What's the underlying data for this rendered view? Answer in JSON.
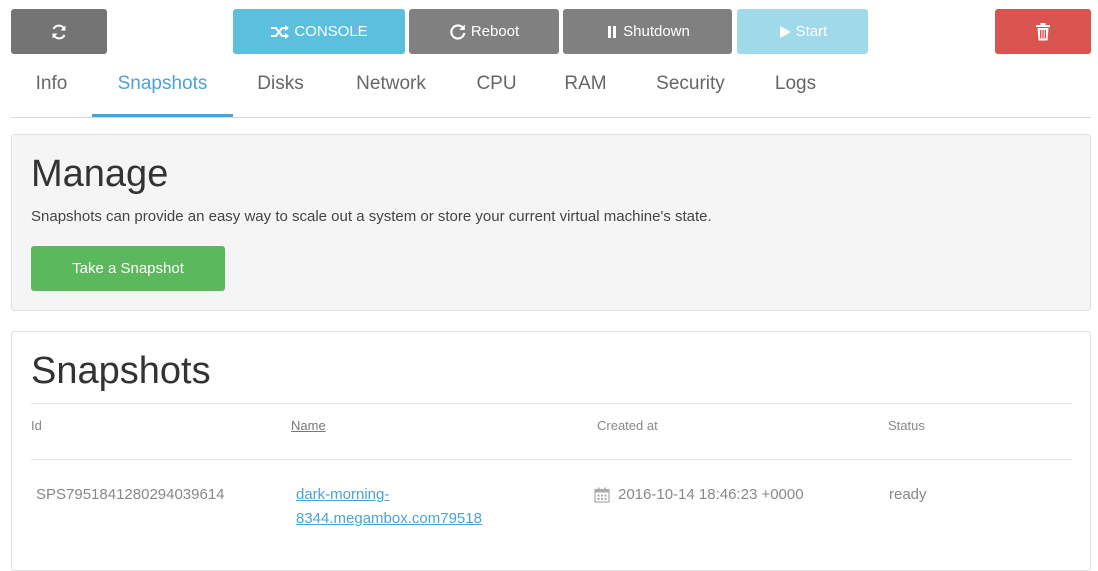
{
  "toolbar": {
    "refresh_icon": "refresh-icon",
    "console_label": "CONSOLE",
    "console_icon": "shuffle-icon",
    "reboot_label": "Reboot",
    "reboot_icon": "reboot-icon",
    "shutdown_label": "Shutdown",
    "shutdown_icon": "pause-icon",
    "start_label": "Start",
    "start_icon": "play-icon",
    "delete_icon": "trash-icon"
  },
  "tabs": [
    {
      "label": "Info"
    },
    {
      "label": "Snapshots",
      "active": true
    },
    {
      "label": "Disks"
    },
    {
      "label": "Network"
    },
    {
      "label": "CPU"
    },
    {
      "label": "RAM"
    },
    {
      "label": "Security"
    },
    {
      "label": "Logs"
    }
  ],
  "manage": {
    "title": "Manage",
    "description": "Snapshots can provide an easy way to scale out a system or store your current virtual machine's state.",
    "button_label": "Take a Snapshot"
  },
  "snapshots": {
    "title": "Snapshots",
    "columns": {
      "id": "Id",
      "name": "Name",
      "created": "Created at",
      "status": "Status"
    },
    "rows": [
      {
        "id": "SPS7951841280294039614",
        "name_line1": "dark-morning-",
        "name_line2": "8344.megambox.com79518",
        "created": "2016-10-14 18:46:23 +0000",
        "status": "ready"
      }
    ]
  },
  "colors": {
    "accent": "#4aa3d8",
    "console": "#5bc0de",
    "start": "#9fd9ea",
    "grey_button": "#808080",
    "danger": "#d9534f",
    "success": "#5cb85c"
  }
}
